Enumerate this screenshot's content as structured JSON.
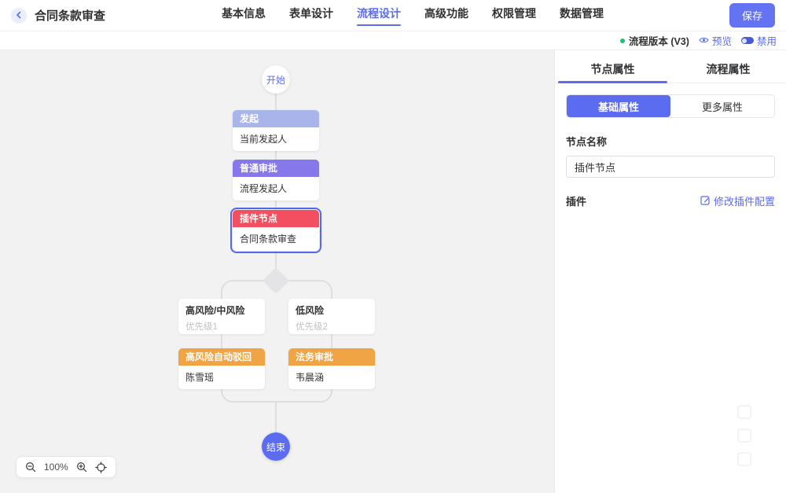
{
  "header": {
    "title": "合同条款审查",
    "tabs": [
      {
        "label": "基本信息"
      },
      {
        "label": "表单设计"
      },
      {
        "label": "流程设计"
      },
      {
        "label": "高级功能"
      },
      {
        "label": "权限管理"
      },
      {
        "label": "数据管理"
      }
    ],
    "active_tab": "流程设计",
    "save_label": "保存"
  },
  "version_bar": {
    "version_label": "流程版本 (V3)",
    "preview_label": "预览",
    "disable_label": "禁用",
    "status_dot_color": "#1fbe77"
  },
  "canvas": {
    "zoom_level": "100%",
    "nodes": {
      "start": {
        "label": "开始"
      },
      "initiate": {
        "title": "发起",
        "body": "当前发起人",
        "color": "#a9b4ea"
      },
      "approval": {
        "title": "普通审批",
        "body": "流程发起人",
        "color": "#8677ea"
      },
      "plugin": {
        "title": "插件节点",
        "body": "合同条款审查",
        "color": "#f25061",
        "selected": true
      },
      "cond_left": {
        "title": "高风险/中风险",
        "subtitle": "优先级1"
      },
      "cond_right": {
        "title": "低风险",
        "subtitle": "优先级2"
      },
      "reject": {
        "title": "高风险自动驳回",
        "body": "陈雪瑶",
        "color": "#f0a443"
      },
      "legal": {
        "title": "法务审批",
        "body": "韦晨涵",
        "color": "#f0a443"
      },
      "end": {
        "label": "结束"
      }
    }
  },
  "panel": {
    "tabs": [
      {
        "label": "节点属性"
      },
      {
        "label": "流程属性"
      }
    ],
    "active_tab": "节点属性",
    "segments": [
      {
        "label": "基础属性"
      },
      {
        "label": "更多属性"
      }
    ],
    "active_segment": "基础属性",
    "fields": {
      "node_name_label": "节点名称",
      "node_name_value": "插件节点",
      "plugin_label": "插件",
      "plugin_action_label": "修改插件配置"
    }
  },
  "colors": {
    "accent": "#5b6cf0",
    "save_button": "#6373f1",
    "status_green": "#1fbe77",
    "node_initiate": "#a9b4ea",
    "node_approval": "#8677ea",
    "node_plugin": "#f25061",
    "node_orange": "#f0a443",
    "selected_border": "#5367f0",
    "canvas_bg": "#f2f2f3",
    "connector": "#d8d8da"
  },
  "icons": {
    "back": "chevron-left-icon",
    "preview": "eye-icon",
    "disable": "toggle-icon",
    "plugin_edit": "edit-square-icon",
    "zoom_out": "magnifier-minus-icon",
    "zoom_in": "magnifier-plus-icon",
    "fit_view": "crosshair-icon"
  }
}
